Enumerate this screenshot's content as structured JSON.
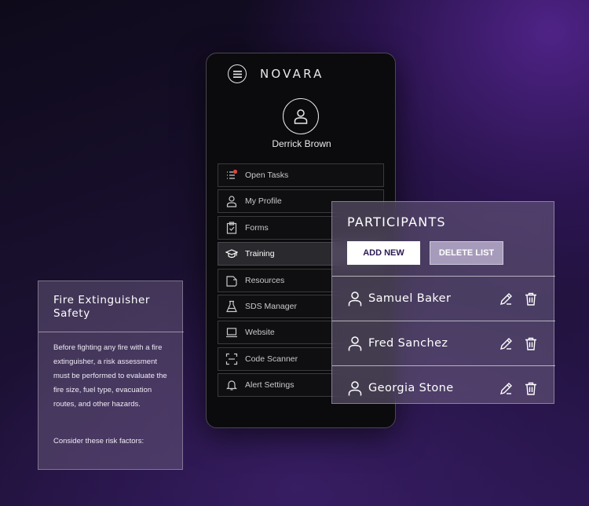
{
  "app": {
    "logo_text": "NOVARA",
    "user_name": "Derrick Brown"
  },
  "nav": {
    "items": [
      {
        "label": "Open Tasks",
        "icon": "tasks-icon"
      },
      {
        "label": "My Profile",
        "icon": "user-icon"
      },
      {
        "label": "Forms",
        "icon": "clipboard-check-icon"
      },
      {
        "label": "Training",
        "icon": "graduation-cap-icon",
        "active": true
      },
      {
        "label": "Resources",
        "icon": "folder-icon"
      },
      {
        "label": "SDS Manager",
        "icon": "flask-icon"
      },
      {
        "label": "Website",
        "icon": "laptop-icon"
      },
      {
        "label": "Code Scanner",
        "icon": "scanner-icon"
      },
      {
        "label": "Alert Settings",
        "icon": "bell-icon"
      }
    ]
  },
  "participants": {
    "title": "PARTICIPANTS",
    "add_label": "ADD NEW",
    "delete_label": "DELETE LIST",
    "rows": [
      {
        "name": "Samuel Baker"
      },
      {
        "name": "Fred Sanchez"
      },
      {
        "name": "Georgia Stone"
      }
    ]
  },
  "fire_card": {
    "title": "Fire Extinguisher Safety",
    "body": "Before fighting any fire with a fire extinguisher, a risk assessment must be performed to evaluate the fire size, fuel type, evacuation routes, and other hazards.",
    "footer": "Consider these risk factors:"
  },
  "colors": {
    "accent_purple": "#2b1a55",
    "badge_red": "#e0453a"
  }
}
